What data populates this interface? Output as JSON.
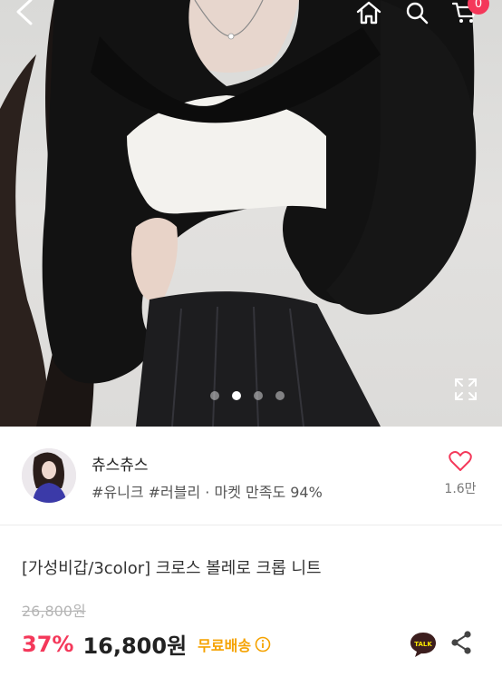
{
  "header": {
    "back_icon": "chevron-left-icon",
    "home_icon": "home-icon",
    "search_icon": "search-icon",
    "cart_icon": "cart-icon",
    "cart_count": "0",
    "badge_color": "#f4385a"
  },
  "gallery": {
    "slide_count": 4,
    "active_index": 1,
    "expand_icon": "expand-icon"
  },
  "seller": {
    "name": "츄스츄스",
    "tags": "#유니크 #러블리 · 마켓 만족도 94%",
    "like_count": "1.6만",
    "like_icon": "heart-outline-icon"
  },
  "product": {
    "title": "[가성비갑/3color] 크로스 볼레로 크롭 니트",
    "original_price": "26,800원",
    "discount": "37%",
    "price": "16,800원",
    "shipping": "무료배송",
    "accent_color": "#f4385a",
    "shipping_color": "#f5a200"
  },
  "actions": {
    "talk_label": "TALK",
    "share_icon": "share-icon"
  }
}
